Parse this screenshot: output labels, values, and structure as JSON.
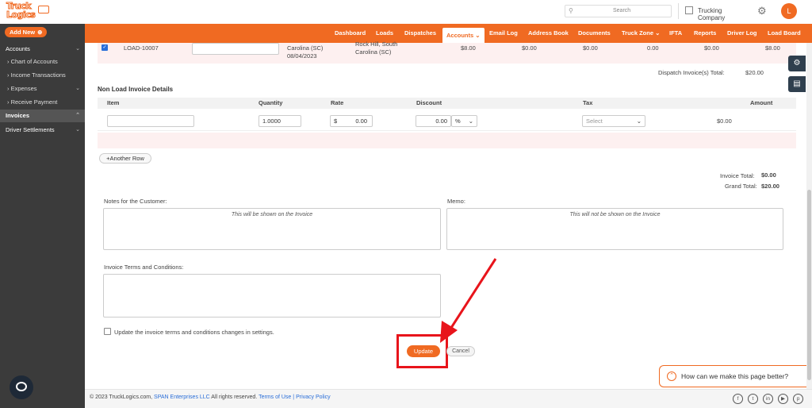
{
  "header": {
    "logo_line1": "Truck",
    "logo_line2": "Logics",
    "search_placeholder": "Search",
    "company": "Trucking Company",
    "avatar_initial": "L"
  },
  "sidebar": {
    "add_new": "Add New",
    "items": [
      {
        "label": "Accounts"
      },
      {
        "label": "› Chart of Accounts"
      },
      {
        "label": "› Income Transactions"
      },
      {
        "label": "› Expenses"
      },
      {
        "label": "› Receive Payment"
      },
      {
        "label": "Invoices"
      },
      {
        "label": "Driver Settlements"
      }
    ]
  },
  "nav": {
    "items": [
      "Dashboard",
      "Loads",
      "Dispatches",
      "Accounts",
      "Email Log",
      "Address Book",
      "Documents",
      "Truck Zone",
      "IFTA",
      "Reports",
      "Driver Log",
      "Load Board"
    ],
    "active": "Accounts"
  },
  "load_row": {
    "load_id": "LOAD-10007",
    "origin_line1": "Carolina (SC)",
    "origin_date": "08/04/2023",
    "dest_line1": "Rock Hill, South",
    "dest_line2": "Carolina (SC)",
    "amount1": "$8.00",
    "amount2": "$0.00",
    "amount3": "$0.00",
    "amount4": "0.00",
    "amount5": "$0.00",
    "amount6": "$8.00"
  },
  "dispatch_total": {
    "label": "Dispatch Invoice(s) Total:",
    "value": "$20.00"
  },
  "non_load": {
    "title": "Non Load Invoice Details",
    "columns": [
      "Item",
      "Quantity",
      "Rate",
      "Discount",
      "Tax",
      "Amount"
    ],
    "row": {
      "item": "",
      "quantity": "1.0000",
      "rate_currency": "$",
      "rate": "0.00",
      "discount": "0.00",
      "discount_type": "%",
      "tax_placeholder": "Select",
      "amount": "$0.00"
    },
    "another_row": "Another Row"
  },
  "totals": {
    "invoice_label": "Invoice Total:",
    "invoice_value": "$0.00",
    "grand_label": "Grand Total:",
    "grand_value": "$20.00"
  },
  "notes": {
    "customer_label": "Notes for the Customer:",
    "customer_hint": "This will be shown on the Invoice",
    "memo_label": "Memo:",
    "memo_hint": "This will not be shown on the Invoice",
    "terms_label": "Invoice Terms and Conditions:",
    "update_terms_label": "Update the invoice terms and conditions changes in settings."
  },
  "actions": {
    "update": "Update",
    "cancel": "Cancel"
  },
  "feedback": {
    "text": "How can we make this page better?"
  },
  "footer": {
    "copyright": "© 2023 TruckLogics.com,",
    "company_link": "SPAN Enterprises LLC",
    "rights": "All rights reserved.",
    "terms": "Terms of Use",
    "sep": "|",
    "privacy": "Privacy Policy",
    "social": [
      "f",
      "t",
      "in",
      "▶",
      "p"
    ]
  },
  "colors": {
    "brand": "#f06a22",
    "sidebar": "#3b3b3b",
    "highlight": "#e8141b",
    "link": "#2a6ed8"
  }
}
